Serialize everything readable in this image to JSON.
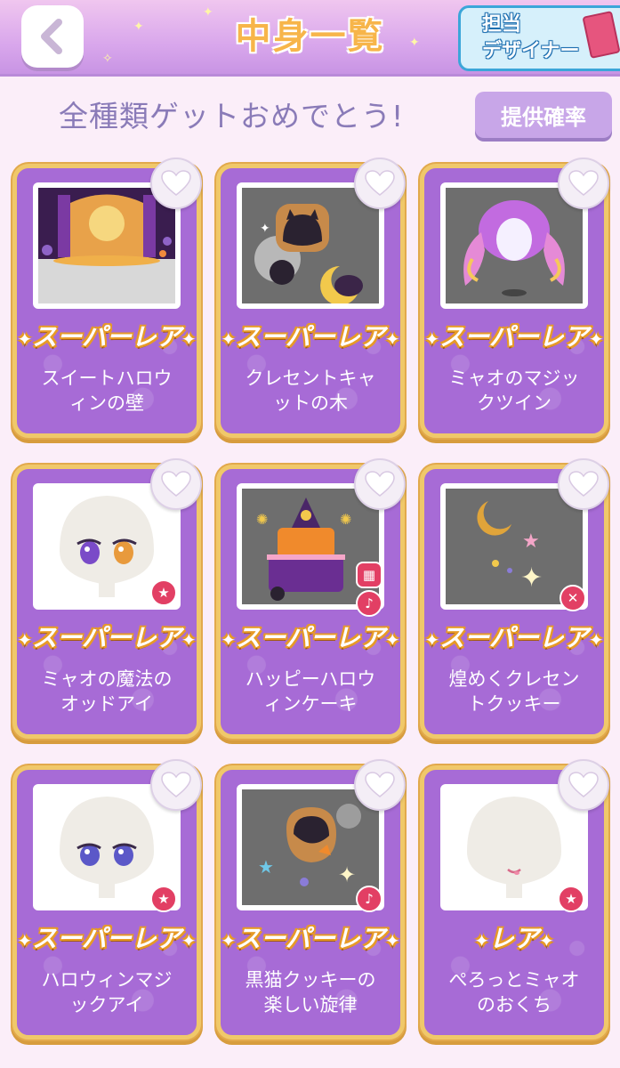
{
  "header": {
    "title": "中身一覧",
    "designer_label_1": "担当",
    "designer_label_2": "デザイナー"
  },
  "subheader": {
    "message": "全種類ゲットおめでとう!",
    "rate_button": "提供確率"
  },
  "colors": {
    "card_purple": "#a76bd6",
    "card_border_gold": "#f0c86a",
    "badge_red": "#e23f64"
  },
  "items": [
    {
      "rarity": "スーパーレア",
      "name_line1": "スイートハロウ",
      "name_line2": "ィンの壁",
      "thumb": "stage-scene",
      "favorite": false
    },
    {
      "rarity": "スーパーレア",
      "name_line1": "クレセントキャ",
      "name_line2": "ットの木",
      "thumb": "cat-cookies",
      "favorite": false
    },
    {
      "rarity": "スーパーレア",
      "name_line1": "ミャオのマジッ",
      "name_line2": "クツイン",
      "thumb": "twin-hair",
      "favorite": false
    },
    {
      "rarity": "スーパーレア",
      "name_line1": "ミャオの魔法の",
      "name_line2": "オッドアイ",
      "thumb": "odd-eyes",
      "favorite": false,
      "badges": [
        "star-badge-icon"
      ]
    },
    {
      "rarity": "スーパーレア",
      "name_line1": "ハッピーハロウ",
      "name_line2": "ィンケーキ",
      "thumb": "cake",
      "favorite": false,
      "badges": [
        "gift-badge-icon",
        "music-badge-icon"
      ]
    },
    {
      "rarity": "スーパーレア",
      "name_line1": "煌めくクレセン",
      "name_line2": "トクッキー",
      "thumb": "moon-sparkle",
      "favorite": false,
      "badges": [
        "tool-badge-icon"
      ]
    },
    {
      "rarity": "スーパーレア",
      "name_line1": "ハロウィンマジ",
      "name_line2": "ックアイ",
      "thumb": "magic-eyes",
      "favorite": false,
      "badges": [
        "star-badge-icon"
      ]
    },
    {
      "rarity": "スーパーレア",
      "name_line1": "黒猫クッキーの",
      "name_line2": "楽しい旋律",
      "thumb": "black-cat-cookie",
      "favorite": false,
      "badges": [
        "music-badge-icon"
      ]
    },
    {
      "rarity": "レア",
      "name_line1": "ぺろっとミャオ",
      "name_line2": "のおくち",
      "thumb": "mouth",
      "favorite": false,
      "badges": [
        "star-badge-icon"
      ]
    }
  ]
}
